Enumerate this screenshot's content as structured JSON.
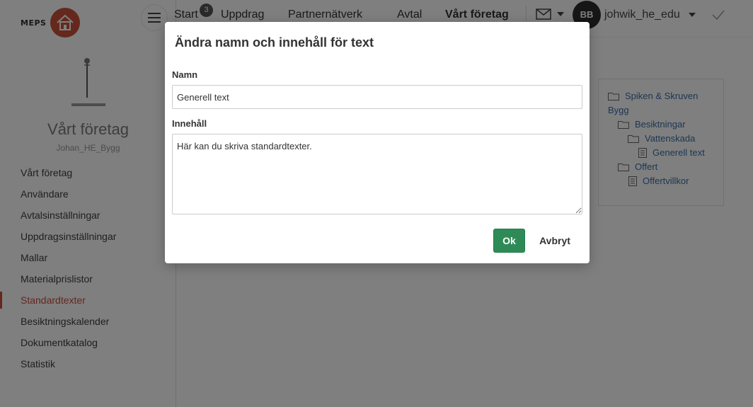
{
  "brand": {
    "name": "MEPS",
    "accent_color": "#c9503a"
  },
  "company": {
    "title": "Vårt företag",
    "subtitle": "Johan_HE_Bygg"
  },
  "sidebar": {
    "items": [
      {
        "label": "Vårt företag"
      },
      {
        "label": "Användare"
      },
      {
        "label": "Avtalsinställningar"
      },
      {
        "label": "Uppdragsinställningar"
      },
      {
        "label": "Mallar"
      },
      {
        "label": "Materialprislistor"
      },
      {
        "label": "Standardtexter",
        "active": true
      },
      {
        "label": "Besiktningskalender"
      },
      {
        "label": "Dokumentkatalog"
      },
      {
        "label": "Statistik"
      }
    ]
  },
  "topnav": {
    "items": [
      {
        "label": "Start",
        "badge": "3"
      },
      {
        "label": "Uppdrag"
      },
      {
        "label": "Partnernätverk"
      },
      {
        "label": "Avtal"
      },
      {
        "label": "Vårt företag",
        "active": true
      }
    ]
  },
  "user": {
    "initials": "BB",
    "name": "johwik_he_edu"
  },
  "tree": {
    "nodes": [
      {
        "label": "Spiken & Skruven",
        "icon": "folder-icon"
      },
      {
        "label": "Bygg",
        "icon": ""
      },
      {
        "label": "Besiktningar",
        "icon": "folder-icon"
      },
      {
        "label": "Vattenskada",
        "icon": "folder-icon"
      },
      {
        "label": "Generell text",
        "icon": "document-icon"
      },
      {
        "label": "Offert",
        "icon": "folder-icon"
      },
      {
        "label": "Offertvillkor",
        "icon": "document-icon"
      }
    ]
  },
  "modal": {
    "title": "Ändra namn och innehåll för text",
    "name_label": "Namn",
    "name_value": "Generell text",
    "content_label": "Innehåll",
    "content_value": "Här kan du skriva standardtexter.",
    "ok_label": "Ok",
    "cancel_label": "Avbryt",
    "ok_color": "#2e8b57"
  }
}
